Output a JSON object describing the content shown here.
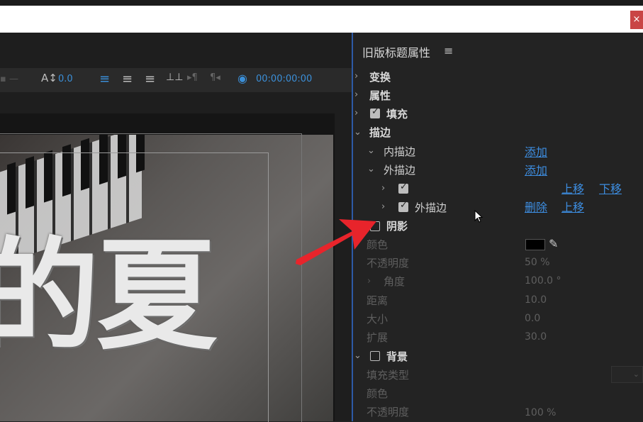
{
  "window": {
    "close_label": "×"
  },
  "toolbar": {
    "kerning_value": "0.0",
    "timecode": "00:00:00:00",
    "kerning_icon": "kerning-icon",
    "align_left_icon": "align-left-icon",
    "align_center_icon": "align-center-icon",
    "align_right_icon": "align-right-icon",
    "tab_ruler_icon": "tab-ruler-icon",
    "eye_icon": "eye-icon"
  },
  "canvas": {
    "title_text": "的夏"
  },
  "panel": {
    "title": "旧版标题属性",
    "menu_icon": "≡",
    "sections": {
      "transform": "变换",
      "properties": "属性",
      "fill": "填充",
      "stroke": "描边",
      "inner_stroke": "内描边",
      "outer_stroke": "外描边",
      "outer_stroke_item": "外描边",
      "shadow": "阴影",
      "background": "背景"
    },
    "links": {
      "add_inner": "添加",
      "add_outer": "添加",
      "move_up_1": "上移",
      "move_down_1": "下移",
      "delete_2": "删除",
      "move_up_2": "上移"
    },
    "shadow_props": {
      "color_label": "颜色",
      "opacity_label": "不透明度",
      "opacity_value": "50 %",
      "angle_label": "角度",
      "angle_value": "100.0 °",
      "distance_label": "距离",
      "distance_value": "10.0",
      "size_label": "大小",
      "size_value": "0.0",
      "spread_label": "扩展",
      "spread_value": "30.0",
      "swatch_color": "#000000"
    },
    "background_props": {
      "fill_type_label": "填充类型",
      "color_label": "颜色",
      "opacity_label": "不透明度",
      "opacity_value": "100 %"
    },
    "checkboxes": {
      "fill": true,
      "stroke_item_1": true,
      "stroke_item_2": true,
      "shadow": false,
      "background": false
    }
  },
  "annotation": {
    "arrow_color": "#e8242b"
  }
}
